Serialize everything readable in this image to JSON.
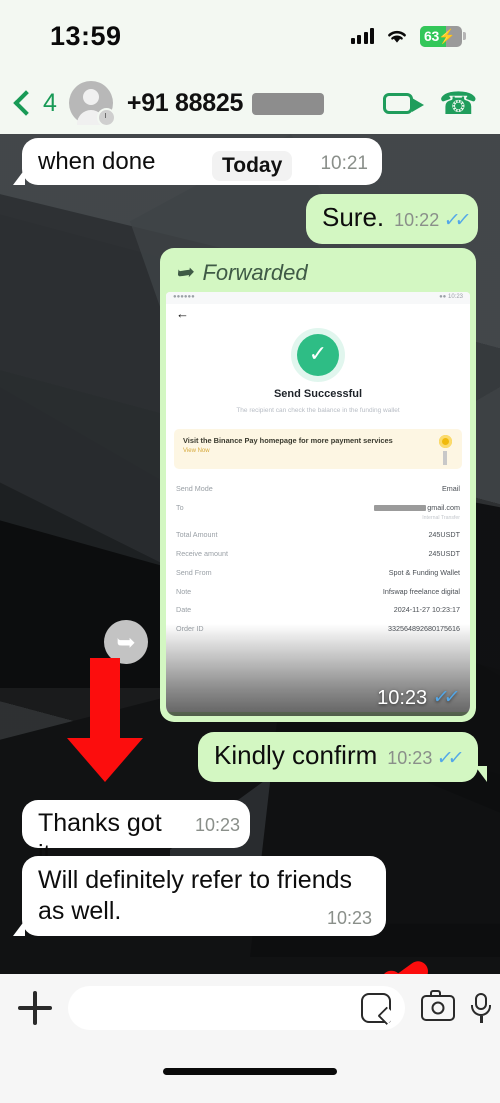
{
  "status_bar": {
    "time": "13:59",
    "battery_percent": "63",
    "battery_bolt": "⚡",
    "signal_icon": "signal-bars-icon",
    "wifi_icon": "wifi-icon"
  },
  "header": {
    "back_icon": "back-chevron-icon",
    "unread_count": "4",
    "avatar_icon": "contact-avatar-icon",
    "disappearing_icon": "disappearing-messages-timer-icon",
    "contact_name": "+91 88825",
    "video_call_icon": "video-call-icon",
    "voice_call_icon": "voice-call-icon"
  },
  "chat": {
    "date_divider": "Today",
    "messages": [
      {
        "id": "when-done",
        "direction": "incoming",
        "text": "when done",
        "time": "10:21"
      },
      {
        "id": "sure",
        "direction": "outgoing",
        "text": "Sure.",
        "time": "10:22",
        "ticks": "✓✓"
      },
      {
        "id": "forwarded-image",
        "direction": "outgoing",
        "forwarded_label": "Forwarded",
        "forward_icon": "forward-arrow-icon",
        "time": "10:23",
        "ticks": "✓✓",
        "share_icon": "share-forward-button-icon"
      },
      {
        "id": "kindly-confirm",
        "direction": "outgoing",
        "text": "Kindly confirm",
        "time": "10:23",
        "ticks": "✓✓"
      },
      {
        "id": "thanks",
        "direction": "incoming",
        "text": "Thanks got it.",
        "time": "10:23"
      },
      {
        "id": "refer",
        "direction": "incoming",
        "text": "Will definitely refer to friends as well.",
        "time": "10:23"
      }
    ]
  },
  "forwarded_screenshot": {
    "back_icon": "back-arrow-icon",
    "success_icon": "success-check-icon",
    "title": "Send Successful",
    "subtitle": "The recipient can check the balance in the funding wallet",
    "promo_text": "Visit the Binance Pay homepage for more payment services",
    "promo_link": "View Now",
    "coin_icon": "binance-coin-icon",
    "details": [
      {
        "label": "Send Mode",
        "value": "Email"
      },
      {
        "label": "To",
        "value": "gmail.com",
        "redacted": true,
        "sub": "Internal Transfer"
      },
      {
        "label": "Total Amount",
        "value": "245USDT"
      },
      {
        "label": "Receive amount",
        "value": "245USDT"
      },
      {
        "label": "Send From",
        "value": "Spot & Funding Wallet"
      },
      {
        "label": "Note",
        "value": "Infswap freelance digital"
      },
      {
        "label": "Date",
        "value": "2024-11-27 10:23:17"
      },
      {
        "label": "Order ID",
        "value": "332564892680175616"
      }
    ]
  },
  "annotations": [
    {
      "name": "red-down-arrow",
      "color": "#fc0d0d"
    },
    {
      "name": "red-left-arrow",
      "color": "#fc0d0d"
    }
  ],
  "composer": {
    "attach_icon": "plus-attach-icon",
    "input_value": "",
    "input_placeholder": "",
    "sticker_icon": "sticker-icon",
    "camera_icon": "camera-icon",
    "mic_icon": "microphone-icon"
  },
  "colors": {
    "header_bg": "#f3f8f2",
    "outgoing_bubble": "#d3f7c2",
    "incoming_bubble": "#ffffff",
    "accent_green": "#1f9d5c",
    "tick_blue": "#53a7e8",
    "battery_green": "#33c759",
    "annotation_red": "#fc0d0d"
  }
}
